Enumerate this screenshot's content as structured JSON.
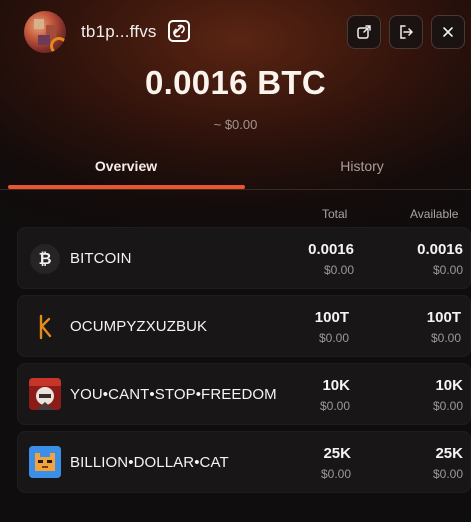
{
  "header": {
    "address": "tb1p...ffvs",
    "icons": [
      "avatar",
      "link-icon",
      "open-external-icon",
      "logout-icon",
      "close-icon"
    ]
  },
  "balance": {
    "amount": "0.0016 BTC",
    "fiat": "~ $0.00"
  },
  "tabs": [
    {
      "label": "Overview",
      "active": true
    },
    {
      "label": "History",
      "active": false
    }
  ],
  "table": {
    "columns": {
      "total": "Total",
      "available": "Available"
    },
    "rows": [
      {
        "name": "BITCOIN",
        "total": "0.0016",
        "total_fiat": "$0.00",
        "available": "0.0016",
        "available_fiat": "$0.00",
        "icon": "bitcoin-icon"
      },
      {
        "name": "OCUMPYZXUZBUK",
        "total": "100T",
        "total_fiat": "$0.00",
        "available": "100T",
        "available_fiat": "$0.00",
        "icon": "rune-icon"
      },
      {
        "name": "YOU•CANT•STOP•FREEDOM",
        "total": "10K",
        "total_fiat": "$0.00",
        "available": "10K",
        "available_fiat": "$0.00",
        "icon": "freedom-token-icon"
      },
      {
        "name": "BILLION•DOLLAR•CAT",
        "total": "25K",
        "total_fiat": "$0.00",
        "available": "25K",
        "available_fiat": "$0.00",
        "icon": "cat-token-icon"
      }
    ]
  },
  "colors": {
    "accent": "#e8552e",
    "rune_orange": "#e38a1c",
    "background": "#0e0c0c"
  }
}
